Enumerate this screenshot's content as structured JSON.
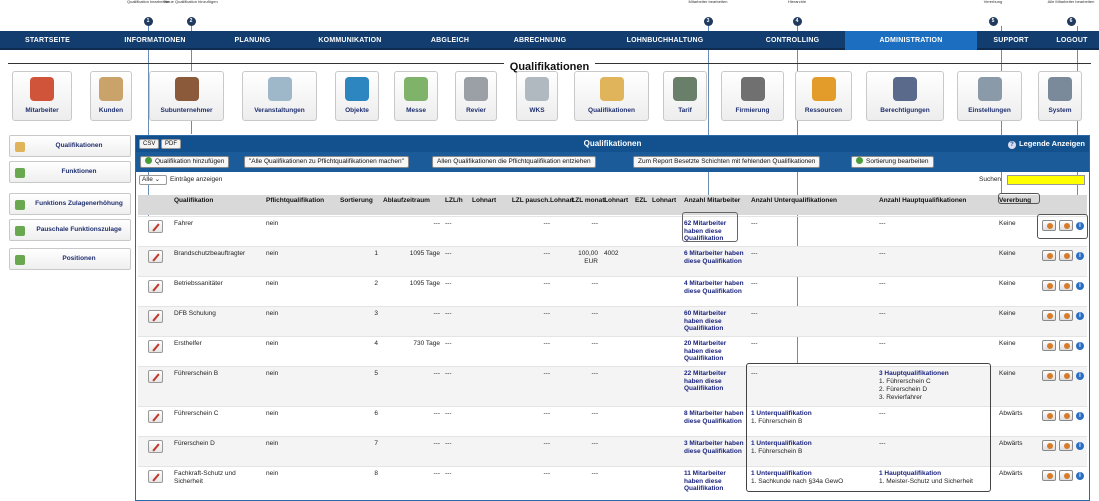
{
  "callouts": [
    {
      "n": "1",
      "text": "Qualifikation bearbeiten"
    },
    {
      "n": "2",
      "text": "Neue Qualifikation hinzufügen"
    },
    {
      "n": "3",
      "text": "Mitarbeiter bearbeiten"
    },
    {
      "n": "4",
      "text": "Hierarchie"
    },
    {
      "n": "5",
      "text": "Vererbung"
    },
    {
      "n": "6",
      "text": "Alle Mitarbeiter bearbeiten"
    }
  ],
  "nav": [
    "STARTSEITE",
    "INFORMATIONEN",
    "PLANUNG",
    "KOMMUNIKATION",
    "ABGLEICH",
    "ABRECHNUNG",
    "LOHNBUCHHALTUNG",
    "CONTROLLING",
    "ADMINISTRATION",
    "SUPPORT",
    "LOGOUT"
  ],
  "active_nav": "ADMINISTRATION",
  "page_title": "Qualifikationen",
  "tiles": [
    {
      "label": "Mitarbeiter",
      "icon": "users-icon",
      "color": "#d0543a"
    },
    {
      "label": "Kunden",
      "icon": "handshake-icon",
      "color": "#c9a36a"
    },
    {
      "label": "Subunternehmer",
      "icon": "subcontractor-icon",
      "color": "#8a5a3a"
    },
    {
      "label": "Veranstaltungen",
      "icon": "calendar-icon",
      "color": "#9fb8c9"
    },
    {
      "label": "Objekte",
      "icon": "cube-icon",
      "color": "#2e86c1"
    },
    {
      "label": "Messe",
      "icon": "floorplan-icon",
      "color": "#7fb36a"
    },
    {
      "label": "Revier",
      "icon": "car-icon",
      "color": "#9aa0a6"
    },
    {
      "label": "WKS",
      "icon": "clipboard-icon",
      "color": "#b0b8c0"
    },
    {
      "label": "Qualifikationen",
      "icon": "certificate-icon",
      "color": "#e0b45a"
    },
    {
      "label": "Tarif",
      "icon": "scale-icon",
      "color": "#6a7f6a"
    },
    {
      "label": "Firmierung",
      "icon": "phone-icon",
      "color": "#707070"
    },
    {
      "label": "Ressourcen",
      "icon": "boxes-icon",
      "color": "#e39b2a"
    },
    {
      "label": "Berechtigungen",
      "icon": "person-lock-icon",
      "color": "#5a6a8a"
    },
    {
      "label": "Einstellungen",
      "icon": "wrench-icon",
      "color": "#8a9aa8"
    },
    {
      "label": "System",
      "icon": "gear-icon",
      "color": "#7a8a9a"
    }
  ],
  "sidebar": [
    {
      "label": "Qualifikationen",
      "icon": "certificate-icon"
    },
    {
      "label": "Funktionen",
      "icon": "function-icon"
    },
    {
      "label": "Funktions Zulagenerhöhung",
      "icon": "function-icon"
    },
    {
      "label": "Pauschale Funktionszulage",
      "icon": "function-icon"
    },
    {
      "label": "Positionen",
      "icon": "function-icon"
    }
  ],
  "panel": {
    "title": "Qualifikationen",
    "csv": "CSV",
    "pdf": "PDF",
    "legend": "Legende Anzeigen",
    "buttons": [
      "Qualifikation hinzufügen",
      "\"Alle Qualifikationen zu Pflichtqualifikationen machen\"",
      "Allen Qualifikationen die Pflichtqualifikation entziehen",
      "Zum Report Besetzte Schichten mit fehlenden Qualifikationen",
      "Sortierung bearbeiten"
    ],
    "entries_select": "Alle",
    "entries_label": "Einträge anzeigen",
    "search_label": "Suchen"
  },
  "columns": [
    "Qualifikation",
    "Pflichtqualifikation",
    "Sortierung",
    "Ablaufzeitraum",
    "LZL/h",
    "Lohnart",
    "LZL pausch.",
    "Lohnart",
    "LZL monatl.",
    "Lohnart",
    "EZL",
    "Lohnart",
    "Anzahl Mitarbeiter",
    "Anzahl Unterqualifikationen",
    "Anzahl Hauptqualifikationen",
    "Vererbung"
  ],
  "rows": [
    {
      "name": "Fahrer",
      "pflicht": "nein",
      "sort": "",
      "ablauf": "---",
      "lzlh": "---",
      "lzlp": "---",
      "lzlm": "---",
      "ma": "62 Mitarbeiter haben diese Qualifikation",
      "uq": [
        "---"
      ],
      "hq": [
        "---"
      ],
      "ver": "Keine"
    },
    {
      "name": "Brandschutzbeauftragter",
      "pflicht": "nein",
      "sort": "1",
      "ablauf": "1095 Tage",
      "lzlh": "---",
      "lzlp": "---",
      "lzlm": "100,00 EUR",
      "lohnart_m": "4002",
      "ma": "6 Mitarbeiter haben diese Qualifikation",
      "uq": [
        "---"
      ],
      "hq": [
        "---"
      ],
      "ver": "Keine"
    },
    {
      "name": "Betriebssanitäter",
      "pflicht": "nein",
      "sort": "2",
      "ablauf": "1095 Tage",
      "lzlh": "---",
      "lzlp": "---",
      "lzlm": "---",
      "ma": "4 Mitarbeiter haben diese Qualifikation",
      "uq": [
        "---"
      ],
      "hq": [
        "---"
      ],
      "ver": "Keine"
    },
    {
      "name": "DFB Schulung",
      "pflicht": "nein",
      "sort": "3",
      "ablauf": "---",
      "lzlh": "---",
      "lzlp": "---",
      "lzlm": "---",
      "ma": "60 Mitarbeiter haben diese Qualifikation",
      "uq": [
        "---"
      ],
      "hq": [
        "---"
      ],
      "ver": "Keine"
    },
    {
      "name": "Ersthelfer",
      "pflicht": "nein",
      "sort": "4",
      "ablauf": "730 Tage",
      "lzlh": "---",
      "lzlp": "---",
      "lzlm": "---",
      "ma": "20 Mitarbeiter haben diese Qualifikation",
      "uq": [
        "---"
      ],
      "hq": [
        "---"
      ],
      "ver": "Keine"
    },
    {
      "name": "Führerschein B",
      "pflicht": "nein",
      "sort": "5",
      "ablauf": "---",
      "lzlh": "---",
      "lzlp": "---",
      "lzlm": "---",
      "ma": "22 Mitarbeiter haben diese Qualifikation",
      "uq": [
        "---"
      ],
      "hq": [
        "3 Hauptqualifikationen",
        "1. Führerschein C",
        "2. Fürerschein D",
        "3. Revierfahrer"
      ],
      "ver": "Keine"
    },
    {
      "name": "Führerschein C",
      "pflicht": "nein",
      "sort": "6",
      "ablauf": "---",
      "lzlh": "---",
      "lzlp": "---",
      "lzlm": "---",
      "ma": "8 Mitarbeiter haben diese Qualifikation",
      "uq": [
        "1 Unterqualifikation",
        "1. Führerschein B"
      ],
      "hq": [
        "---"
      ],
      "ver": "Abwärts"
    },
    {
      "name": "Fürerschein D",
      "pflicht": "nein",
      "sort": "7",
      "ablauf": "---",
      "lzlh": "---",
      "lzlp": "---",
      "lzlm": "---",
      "ma": "3 Mitarbeiter haben diese Qualifikation",
      "uq": [
        "1 Unterqualifikation",
        "1. Führerschein B"
      ],
      "hq": [
        "---"
      ],
      "ver": "Abwärts"
    },
    {
      "name": "Fachkraft-Schutz und Sicherheit",
      "pflicht": "nein",
      "sort": "8",
      "ablauf": "---",
      "lzlh": "---",
      "lzlp": "---",
      "lzlm": "---",
      "ma": "11 Mitarbeiter haben diese Qualifikation",
      "uq": [
        "1 Unterqualifikation",
        "1. Sachkunde nach §34a GewO"
      ],
      "hq": [
        "1 Hauptqualifikation",
        "1. Meister-Schutz und Sicherheit"
      ],
      "ver": "Abwärts"
    }
  ]
}
